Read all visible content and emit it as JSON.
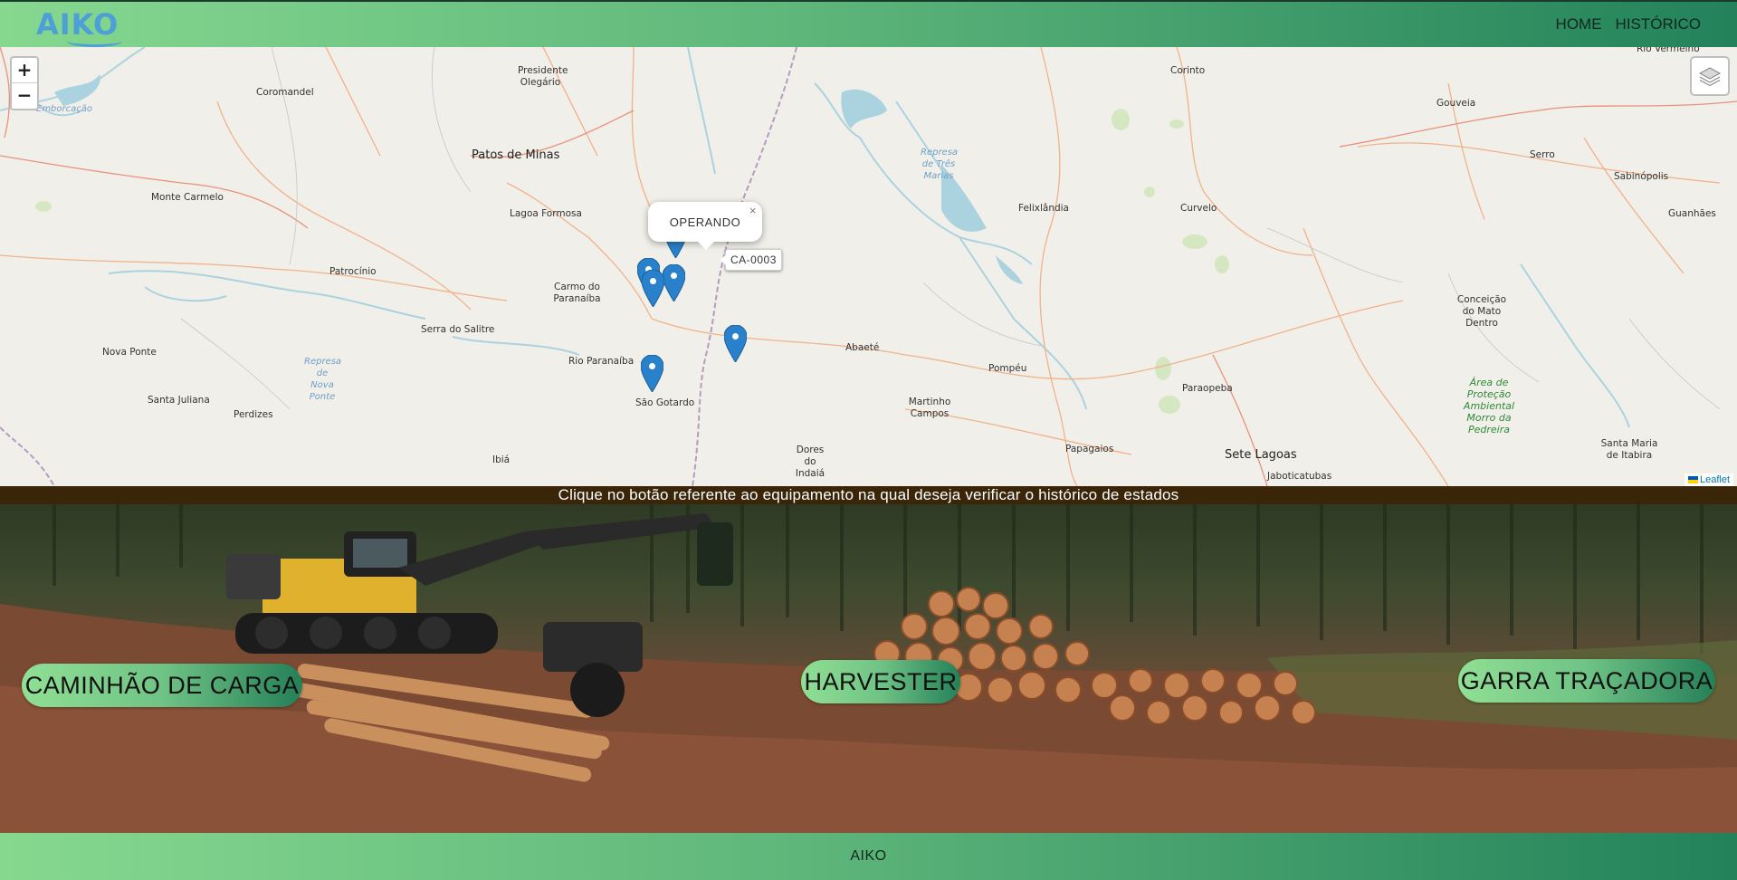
{
  "header": {
    "logo": "AIKO",
    "nav": [
      {
        "label": "HOME"
      },
      {
        "label": "HISTÓRICO"
      }
    ]
  },
  "map": {
    "zoom_in": "+",
    "zoom_out": "−",
    "popup": {
      "text": "OPERANDO",
      "close": "×"
    },
    "tooltip": "CA-0003",
    "attribution": "Leaflet",
    "places": [
      "Rio Vermelho",
      "Presidente Olegário",
      "Coromandel",
      "Patos de Minas",
      "Monte Carmelo",
      "Lagoa Formosa",
      "Patrocínio",
      "Carmo do Paranaíba",
      "Serra do Salitre",
      "Rio Paranaíba",
      "Nova Ponte",
      "Santa Juliana",
      "Perdizes",
      "São Gotardo",
      "Ibiá",
      "Corinto",
      "Gouveia",
      "Serro",
      "Sabinópolis",
      "Guanhães",
      "Felixlândia",
      "Curvelo",
      "Abaeté",
      "Pompéu",
      "Martinho Campos",
      "Dores do Indaiá",
      "Papagaios",
      "Paraopeba",
      "Sete Lagoas",
      "Jaboticatubas",
      "Santa Maria de Itabira",
      "Conceição do Mato Dentro"
    ],
    "water_labels": [
      "Represa de Três Marias",
      "Represa de Nova Ponte",
      "Emborcação"
    ],
    "green_label": "Área de Proteção Ambiental Morro da Pedreira"
  },
  "instruction": "Clique no botão referente ao equipamento na qual deseja verificar o histórico de estados",
  "equipment_buttons": [
    {
      "label": "CAMINHÃO DE CARGA"
    },
    {
      "label": "HARVESTER"
    },
    {
      "label": "GARRA TRAÇADORA"
    }
  ],
  "footer": {
    "text": "AIKO"
  },
  "colors": {
    "header_gradient_start": "#86d88f",
    "header_gradient_end": "#23825a",
    "logo": "#4d9fd8",
    "marker": "#2a81cb",
    "instruction_band": "#3a2509"
  }
}
